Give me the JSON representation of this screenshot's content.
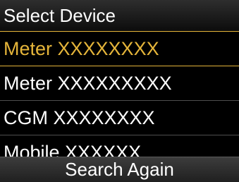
{
  "header": {
    "title": "Select Device"
  },
  "devices": [
    {
      "label": "Meter XXXXXXXX",
      "selected": true
    },
    {
      "label": "Meter XXXXXXXXX",
      "selected": false
    },
    {
      "label": "CGM XXXXXXXX",
      "selected": false
    },
    {
      "label": "Mobile XXXXXX",
      "selected": false
    }
  ],
  "footer": {
    "search_again_label": "Search Again"
  },
  "colors": {
    "background": "#000000",
    "text": "#ffffff",
    "selected_accent": "#e5b53a",
    "divider": "#4e4e4e"
  }
}
